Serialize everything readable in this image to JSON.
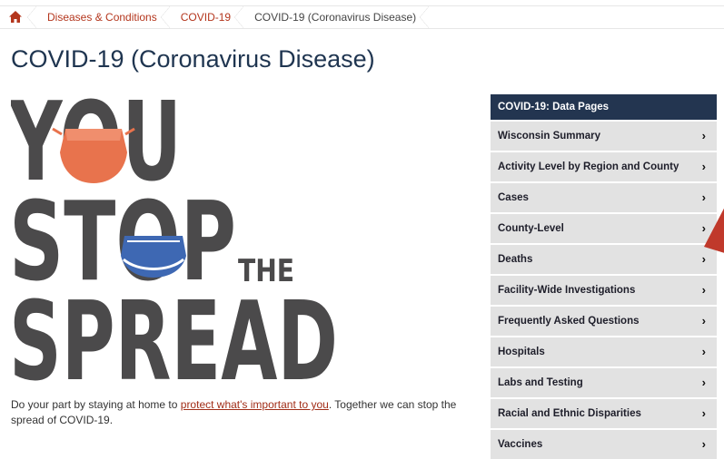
{
  "breadcrumb": [
    {
      "label": "Diseases & Conditions"
    },
    {
      "label": "COVID-19"
    },
    {
      "label": "COVID-19 (Coronavirus Disease)"
    }
  ],
  "page_title": "COVID-19 (Coronavirus Disease)",
  "poster": {
    "lines": [
      "YOU",
      "STOP",
      "THE",
      "SPREAD"
    ],
    "colors": {
      "text": "#4b4a4b",
      "mask_orange": "#e8734d",
      "mask_blue": "#3e68b3"
    }
  },
  "intro": {
    "before": "Do your part by staying at home to ",
    "link": "protect what's important to you",
    "after": ". Together we can stop the spread of COVID-19."
  },
  "sidebar": {
    "title": "COVID-19: Data Pages",
    "items": [
      {
        "label": "Wisconsin Summary"
      },
      {
        "label": "Activity Level by Region and County"
      },
      {
        "label": "Cases"
      },
      {
        "label": "County-Level"
      },
      {
        "label": "Deaths"
      },
      {
        "label": "Facility-Wide Investigations"
      },
      {
        "label": "Frequently Asked Questions"
      },
      {
        "label": "Hospitals"
      },
      {
        "label": "Labs and Testing"
      },
      {
        "label": "Racial and Ethnic Disparities"
      },
      {
        "label": "Vaccines"
      }
    ],
    "chevron": "›",
    "colors": {
      "header_bg": "#233550",
      "item_bg": "#e2e2e2"
    }
  },
  "colors": {
    "link": "#b4361d",
    "title": "#1f3550",
    "accent_triangle": "#c0392b"
  },
  "icons": {
    "home": "home-icon"
  }
}
